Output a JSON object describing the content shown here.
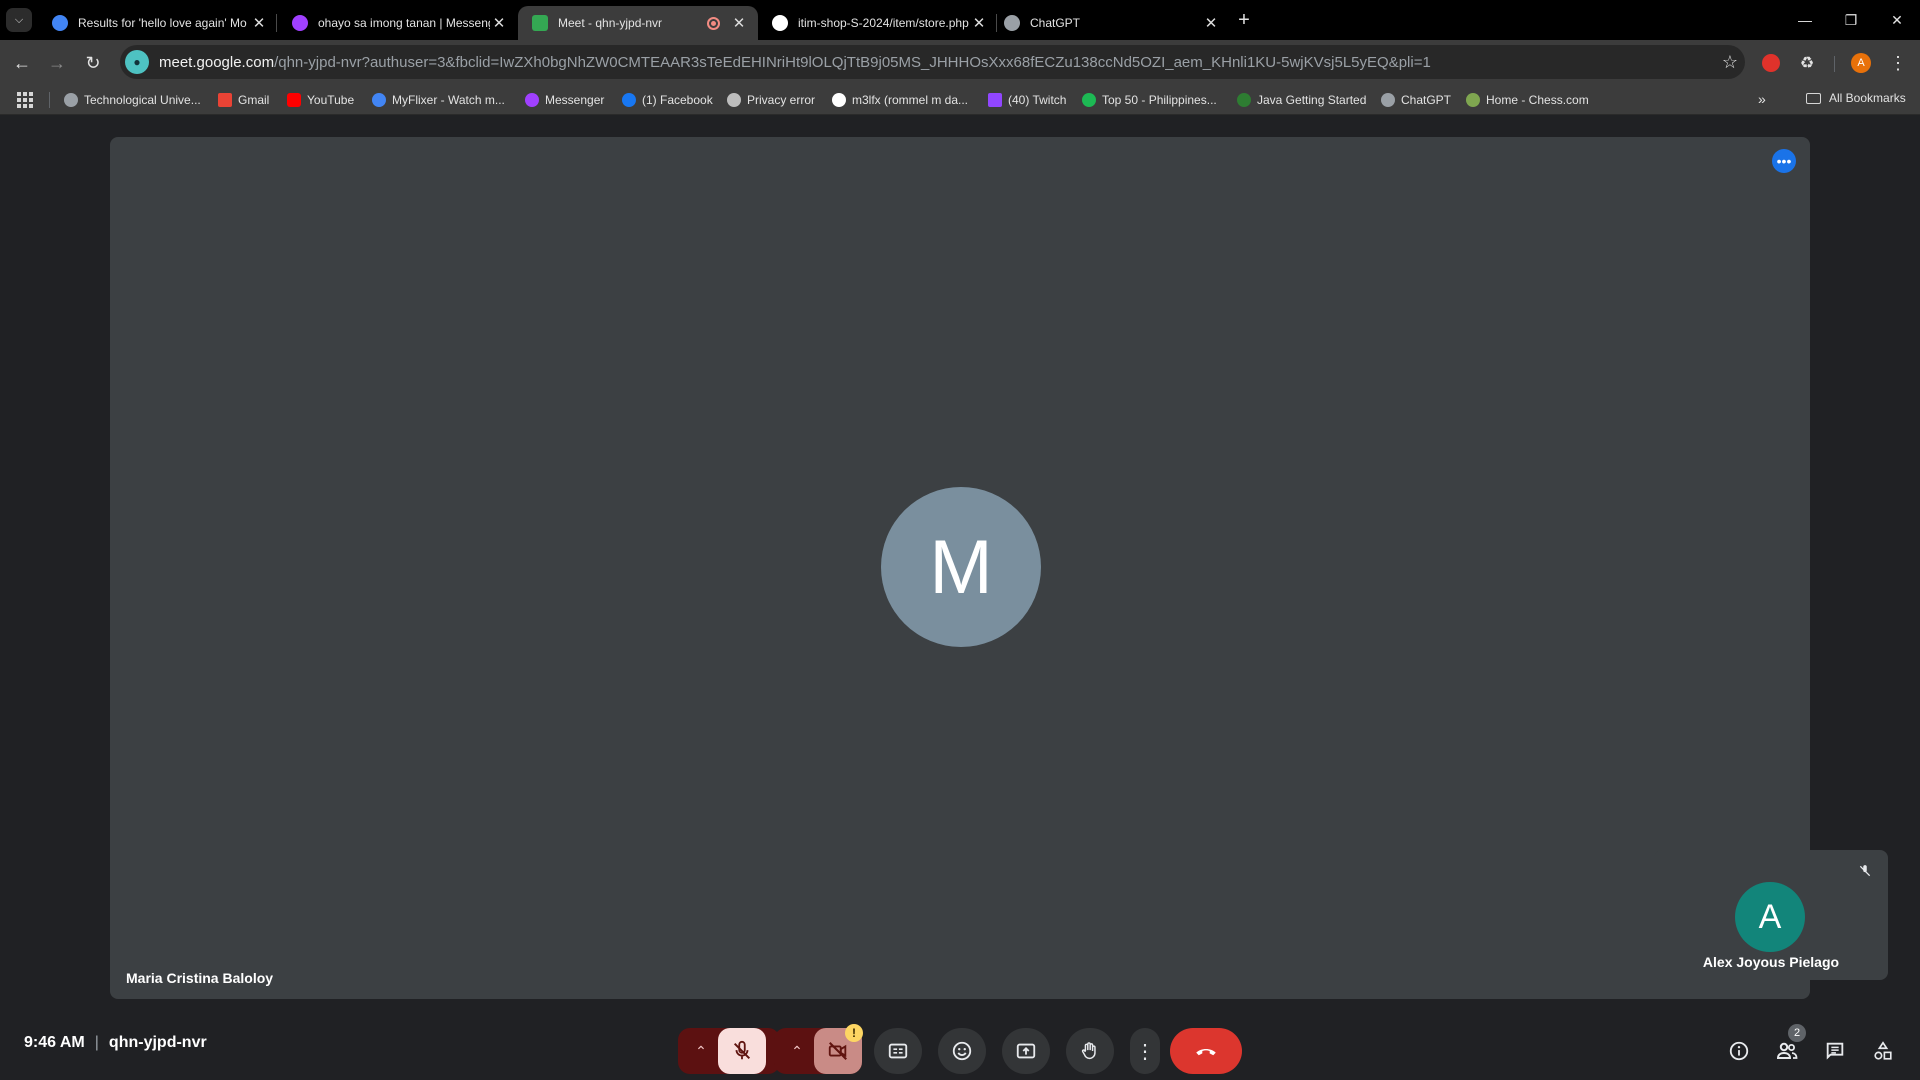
{
  "browser": {
    "tabs": [
      {
        "title": "Results for 'hello love again' Mo",
        "favicon_color": "#4285f4"
      },
      {
        "title": "ohayo sa imong tanan | Messenger",
        "favicon_color": "#a040ff"
      },
      {
        "title": "Meet - qhn-yjpd-nvr",
        "favicon_color": "#34a853"
      },
      {
        "title": "itim-shop-S-2024/item/store.php",
        "favicon_color": "#ffffff"
      },
      {
        "title": "ChatGPT",
        "favicon_color": "#9aa0a6"
      }
    ],
    "url_domain": "meet.google.com",
    "url_path": "/qhn-yjpd-nvr?authuser=3&fbclid=IwZXh0bgNhZW0CMTEAAR3sTeEdEHINriHt9lOLQjTtB9j05MS_JHHHOsXxx68fECZu138ccNd5OZI_aem_KHnli1KU-5wjKVsj5L5yEQ&pli=1",
    "profile_initial": "A",
    "bookmarks": [
      {
        "label": "Technological Unive...",
        "color": "#9aa0a6"
      },
      {
        "label": "Gmail",
        "color": "#ea4335"
      },
      {
        "label": "YouTube",
        "color": "#ff0000"
      },
      {
        "label": "MyFlixer - Watch m...",
        "color": "#4285f4"
      },
      {
        "label": "Messenger",
        "color": "#a040ff"
      },
      {
        "label": "(1) Facebook",
        "color": "#1877f2"
      },
      {
        "label": "Privacy error",
        "color": "#bdbdbd"
      },
      {
        "label": "m3lfx (rommel m da...",
        "color": "#ffffff"
      },
      {
        "label": "(40) Twitch",
        "color": "#9146ff"
      },
      {
        "label": "Top 50 - Philippines...",
        "color": "#1db954"
      },
      {
        "label": "Java Getting Started",
        "color": "#2e7d32"
      },
      {
        "label": "ChatGPT",
        "color": "#9aa0a6"
      },
      {
        "label": "Home - Chess.com",
        "color": "#7fa650"
      }
    ],
    "all_bookmarks_label": "All Bookmarks"
  },
  "meet": {
    "main_participant_initial": "M",
    "main_participant_name": "Maria Cristina Baloloy",
    "self_participant_initial": "A",
    "self_participant_name": "Alex Joyous Pielago",
    "time": "9:46 AM",
    "meeting_code": "qhn-yjpd-nvr",
    "people_count": "2",
    "camera_warning": "!"
  },
  "colors": {
    "main_avatar": "#7a8f9e",
    "self_avatar": "#12857a",
    "hangup": "#dc362e",
    "accent": "#1a73e8"
  }
}
